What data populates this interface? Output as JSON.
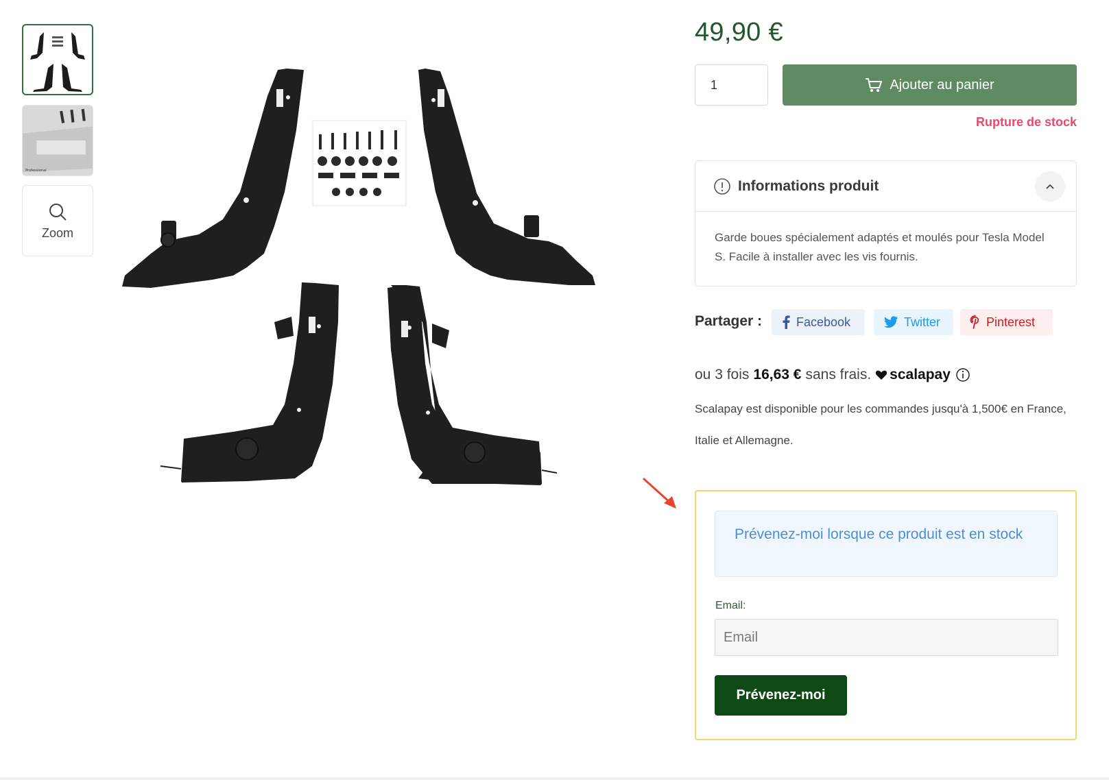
{
  "gallery": {
    "zoom_label": "Zoom",
    "thumb2_caption": "Professional"
  },
  "product": {
    "price": "49,90 €",
    "quantity": "1",
    "add_to_cart_label": "Ajouter au panier",
    "stock_status": "Rupture de stock"
  },
  "info": {
    "title": "Informations produit",
    "text": "Garde boues spécialement adaptés et moulés pour Tesla Model S. Facile à installer avec les vis fournis."
  },
  "share": {
    "label": "Partager :",
    "facebook": "Facebook",
    "twitter": "Twitter",
    "pinterest": "Pinterest"
  },
  "scalapay": {
    "prefix": "ou 3 fois",
    "amount": "16,63 €",
    "suffix": "sans frais.",
    "brand": "scalapay",
    "info": "Scalapay est disponible pour les commandes jusqu'à 1,500€ en France, Italie et Allemagne."
  },
  "notify": {
    "message": "Prévenez-moi lorsque ce produit est en stock",
    "email_label": "Email:",
    "email_placeholder": "Email",
    "button_label": "Prévenez-moi"
  },
  "colors": {
    "price": "#22562c",
    "add_to_cart": "#5f8b63",
    "out_of_stock": "#e84a6b",
    "notify_border": "#f2d56c",
    "notify_button": "#0f4a16",
    "alert_text": "#4a8ed8"
  },
  "icons": [
    "cart-icon",
    "info-circle-icon",
    "chevron-up-icon",
    "facebook-icon",
    "twitter-icon",
    "pinterest-icon",
    "heart-icon",
    "search-icon",
    "arrow-icon"
  ]
}
